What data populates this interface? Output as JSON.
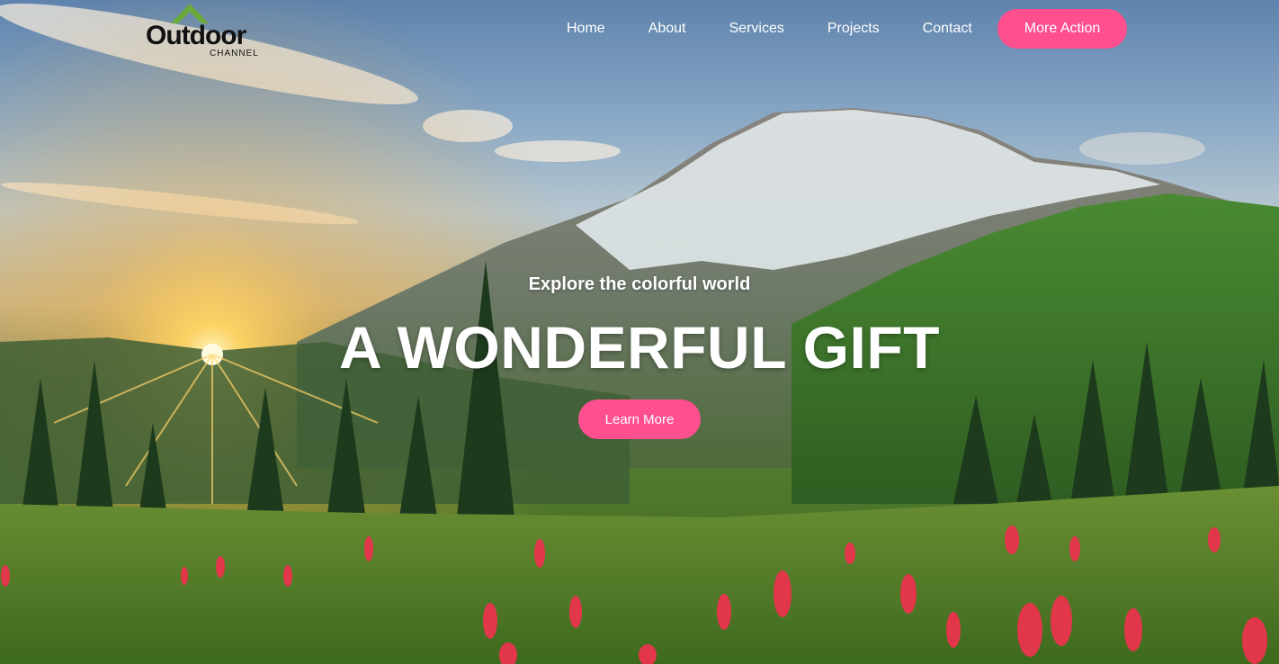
{
  "brand": {
    "name": "Outdoor",
    "tagline": "CHANNEL",
    "mark_color": "#6aaa3a",
    "text_color": "#111111"
  },
  "nav": {
    "items": [
      {
        "label": "Home"
      },
      {
        "label": "About"
      },
      {
        "label": "Services"
      },
      {
        "label": "Projects"
      },
      {
        "label": "Contact"
      }
    ],
    "cta_label": "More Action"
  },
  "hero": {
    "eyebrow": "Explore the colorful world",
    "headline": "A WONDERFUL GIFT",
    "button_label": "Learn More",
    "background_image": "mountain-sunrise-meadow-photo"
  },
  "colors": {
    "accent": "#ff4f8f",
    "text_light": "#ffffff"
  }
}
